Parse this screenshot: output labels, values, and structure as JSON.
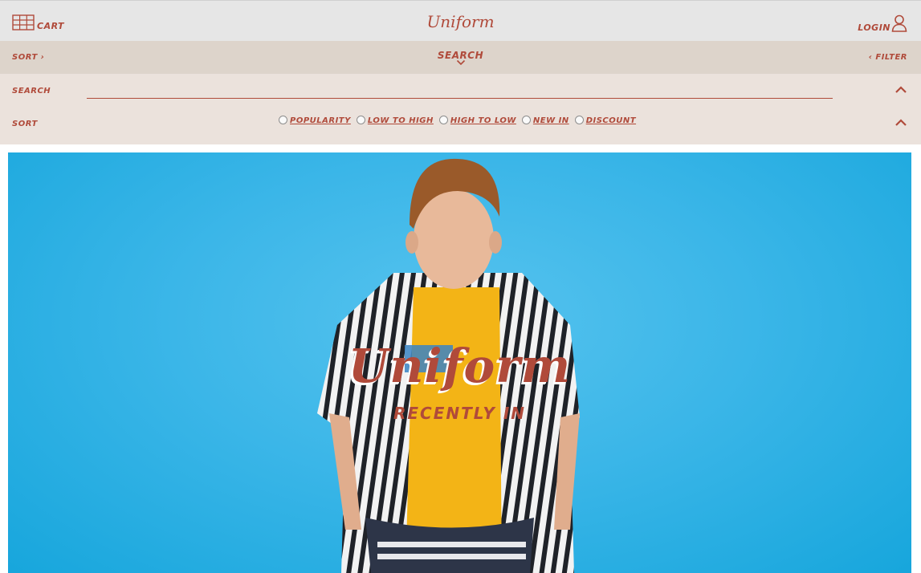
{
  "header": {
    "logo": "Uniform",
    "cart_label": "CART",
    "login_label": "LOGIN"
  },
  "subnav": {
    "sort_label": "SORT",
    "search_label": "SEARCH",
    "filter_label": "FILTER"
  },
  "panel": {
    "search_label": "SEARCH",
    "search_value": "",
    "sort_label": "SORT",
    "sort_options": [
      "POPULARITY",
      "LOW TO HIGH",
      "HIGH TO LOW",
      "NEW IN",
      "DISCOUNT"
    ]
  },
  "hero": {
    "logo": "Uniform",
    "tagline": "RECENTLY IN"
  },
  "colors": {
    "accent": "#b04a3a",
    "topbar": "#e6e6e6",
    "subnav": "#ddd4cb",
    "panel": "#ebe2dc",
    "hero_background": "#3bb6e8"
  },
  "icons": {
    "cart": "grid-cart-icon",
    "login": "user-icon",
    "sort": "chevron-right-icon",
    "search": "chevron-down-icon",
    "filter": "chevron-left-icon",
    "collapse": "chevron-up-icon"
  }
}
